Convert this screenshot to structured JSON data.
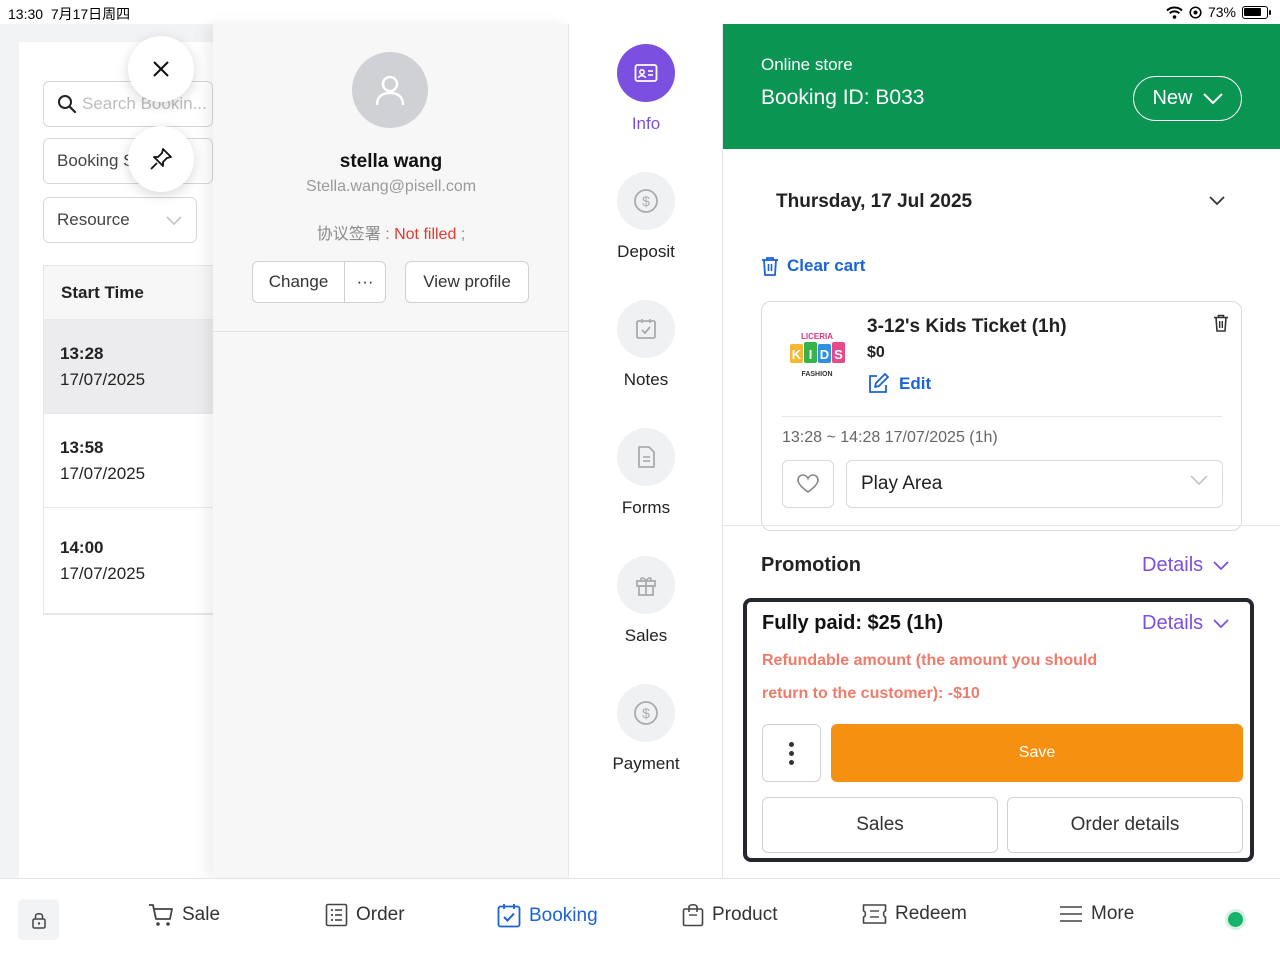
{
  "status_bar": {
    "time": "13:30",
    "date": "7月17日周四",
    "battery": "73%"
  },
  "left_panel": {
    "search_placeholder": "Search Bookin...",
    "booking_filter": "Booking S",
    "resource_filter": "Resource",
    "column_header": "Start Time",
    "rows": [
      {
        "time": "13:28",
        "date": "17/07/2025"
      },
      {
        "time": "13:58",
        "date": "17/07/2025"
      },
      {
        "time": "14:00",
        "date": "17/07/2025"
      }
    ]
  },
  "customer": {
    "name": "stella wang",
    "email": "Stella.wang@pisell.com",
    "agreement_label": "协议签署 : ",
    "agreement_status": "Not filled",
    "agreement_suffix": " ;",
    "change_label": "Change",
    "more_label": "···",
    "view_profile_label": "View profile"
  },
  "nav": {
    "items": [
      {
        "label": "Info",
        "icon": "id-card-icon",
        "active": true
      },
      {
        "label": "Deposit",
        "icon": "dollar-circle-icon",
        "active": false
      },
      {
        "label": "Notes",
        "icon": "calendar-check-icon",
        "active": false
      },
      {
        "label": "Forms",
        "icon": "document-icon",
        "active": false
      },
      {
        "label": "Sales",
        "icon": "gift-icon",
        "active": false
      },
      {
        "label": "Payment",
        "icon": "dollar-circle-icon",
        "active": false
      }
    ]
  },
  "booking": {
    "channel": "Online store",
    "id_text": "Booking ID: B033",
    "status": "New",
    "date": "Thursday, 17 Jul 2025",
    "clear_cart_label": "Clear cart",
    "item": {
      "name": "3-12's Kids Ticket (1h)",
      "price": "$0",
      "edit_label": "Edit",
      "time_range": "13:28 ~ 14:28 17/07/2025 (1h)",
      "resource": "Play Area",
      "logo_text": {
        "top": "LICERIA",
        "main": "KIDS",
        "bottom": "FASHION"
      }
    },
    "promotion_label": "Promotion",
    "details_label": "Details",
    "payment": {
      "title": "Fully paid: $25 (1h)",
      "details_label": "Details",
      "refund_text": "Refundable amount (the amount you should return to the customer): -$10",
      "save_label": "Save",
      "sales_label": "Sales",
      "order_details_label": "Order details"
    },
    "colors": {
      "header": "#0a9552",
      "accent": "#7b4fe0",
      "save": "#f59010",
      "link": "#1c63d8"
    }
  },
  "bottom_nav": {
    "items": [
      {
        "label": "Sale",
        "icon": "cart-icon",
        "active": false
      },
      {
        "label": "Order",
        "icon": "list-icon",
        "active": false
      },
      {
        "label": "Booking",
        "icon": "calendar-check-icon",
        "active": true
      },
      {
        "label": "Product",
        "icon": "bag-icon",
        "active": false
      },
      {
        "label": "Redeem",
        "icon": "ticket-icon",
        "active": false
      },
      {
        "label": "More",
        "icon": "menu-icon",
        "active": false
      }
    ]
  }
}
